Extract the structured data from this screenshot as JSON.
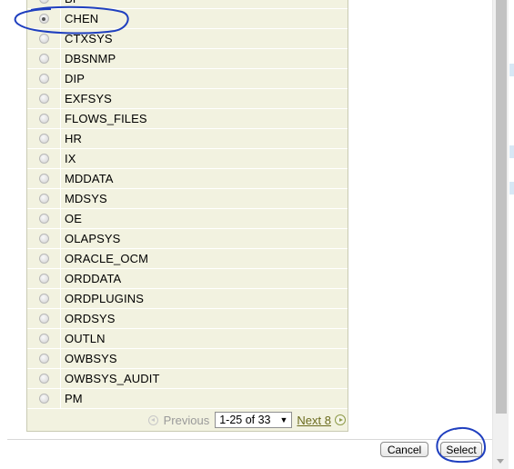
{
  "lov": {
    "rows": [
      {
        "name": "BI",
        "selected": false
      },
      {
        "name": "CHEN",
        "selected": true
      },
      {
        "name": "CTXSYS",
        "selected": false
      },
      {
        "name": "DBSNMP",
        "selected": false
      },
      {
        "name": "DIP",
        "selected": false
      },
      {
        "name": "EXFSYS",
        "selected": false
      },
      {
        "name": "FLOWS_FILES",
        "selected": false
      },
      {
        "name": "HR",
        "selected": false
      },
      {
        "name": "IX",
        "selected": false
      },
      {
        "name": "MDDATA",
        "selected": false
      },
      {
        "name": "MDSYS",
        "selected": false
      },
      {
        "name": "OE",
        "selected": false
      },
      {
        "name": "OLAPSYS",
        "selected": false
      },
      {
        "name": "ORACLE_OCM",
        "selected": false
      },
      {
        "name": "ORDDATA",
        "selected": false
      },
      {
        "name": "ORDPLUGINS",
        "selected": false
      },
      {
        "name": "ORDSYS",
        "selected": false
      },
      {
        "name": "OUTLN",
        "selected": false
      },
      {
        "name": "OWBSYS",
        "selected": false
      },
      {
        "name": "OWBSYS_AUDIT",
        "selected": false
      },
      {
        "name": "PM",
        "selected": false
      }
    ]
  },
  "pager": {
    "previous_label": "Previous",
    "range_value": "1-25 of 33",
    "next_label": "Next 8"
  },
  "buttons": {
    "cancel_label": "Cancel",
    "select_label": "Select"
  },
  "colors": {
    "annotation": "#1f3fbf",
    "row_background": "#f2f2e0",
    "link": "#6b6b1e"
  }
}
